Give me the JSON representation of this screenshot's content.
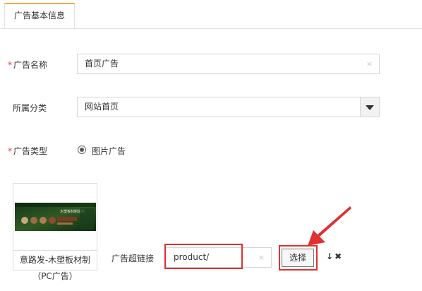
{
  "tab": {
    "label": "广告基本信息"
  },
  "form": {
    "name": {
      "required": "*",
      "label": "广告名称",
      "value": "首页广告",
      "clear": "×"
    },
    "category": {
      "label": "所属分类",
      "value": "网站首页"
    },
    "type": {
      "required": "*",
      "label": "广告类型",
      "option": "图片广告",
      "selected": true
    }
  },
  "image": {
    "name": "意路发-木塑板材制",
    "caption": "（PC广告）",
    "banner_text": "木塑板材制造商"
  },
  "link": {
    "label": "广告超链接",
    "value": "product/",
    "clear": "×",
    "select_label": "选择"
  },
  "colors": {
    "tab_accent": "#f0a848",
    "required": "#e23a2e",
    "highlight": "#e03030"
  },
  "icons": [
    "arrow-down-icon",
    "delete-x-icon",
    "dropdown-arrow-icon",
    "red-pointer-arrow-icon"
  ]
}
